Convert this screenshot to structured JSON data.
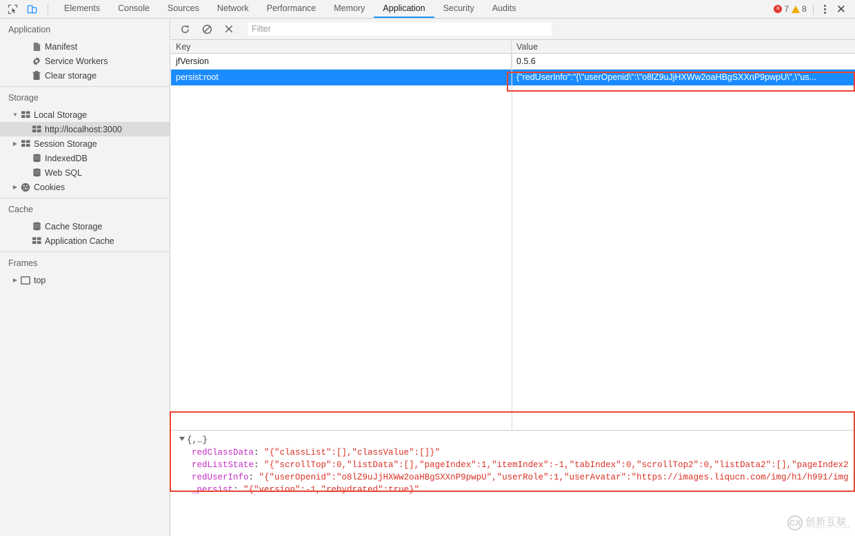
{
  "devtools": {
    "inspect_icon": "inspect-element-icon",
    "device_icon": "device-toolbar-icon",
    "tabs": [
      {
        "label": "Elements",
        "active": false
      },
      {
        "label": "Console",
        "active": false
      },
      {
        "label": "Sources",
        "active": false
      },
      {
        "label": "Network",
        "active": false
      },
      {
        "label": "Performance",
        "active": false
      },
      {
        "label": "Memory",
        "active": false
      },
      {
        "label": "Application",
        "active": true
      },
      {
        "label": "Security",
        "active": false
      },
      {
        "label": "Audits",
        "active": false
      }
    ],
    "error_count": "7",
    "warning_count": "8",
    "error_glyph": "×",
    "menu_icon": "kebab-menu-icon",
    "close_icon": "✕"
  },
  "sidebar": {
    "sections": [
      {
        "title": "Application",
        "items": [
          {
            "label": "Manifest",
            "icon": "manifest-icon",
            "arrow": false,
            "indent": 2,
            "selected": false
          },
          {
            "label": "Service Workers",
            "icon": "gear-icon",
            "arrow": false,
            "indent": 2,
            "selected": false
          },
          {
            "label": "Clear storage",
            "icon": "trash-icon",
            "arrow": false,
            "indent": 2,
            "selected": false
          }
        ]
      },
      {
        "title": "Storage",
        "items": [
          {
            "label": "Local Storage",
            "icon": "table-icon",
            "arrow": true,
            "expanded": true,
            "indent": 1,
            "selected": false
          },
          {
            "label": "http://localhost:3000",
            "icon": "table-icon",
            "arrow": false,
            "indent": 3,
            "selected": true
          },
          {
            "label": "Session Storage",
            "icon": "table-icon",
            "arrow": true,
            "expanded": false,
            "indent": 1,
            "selected": false
          },
          {
            "label": "IndexedDB",
            "icon": "database-icon",
            "arrow": false,
            "indent": 2,
            "selected": false
          },
          {
            "label": "Web SQL",
            "icon": "database-icon",
            "arrow": false,
            "indent": 2,
            "selected": false
          },
          {
            "label": "Cookies",
            "icon": "cookie-icon",
            "arrow": true,
            "expanded": false,
            "indent": 1,
            "selected": false
          }
        ]
      },
      {
        "title": "Cache",
        "items": [
          {
            "label": "Cache Storage",
            "icon": "database-icon",
            "arrow": false,
            "indent": 2,
            "selected": false
          },
          {
            "label": "Application Cache",
            "icon": "table-icon",
            "arrow": false,
            "indent": 2,
            "selected": false
          }
        ]
      },
      {
        "title": "Frames",
        "items": [
          {
            "label": "top",
            "icon": "frame-icon",
            "arrow": true,
            "expanded": false,
            "indent": 1,
            "selected": false
          }
        ]
      }
    ]
  },
  "toolbar": {
    "refresh_icon": "refresh-icon",
    "clear_icon": "clear-all-icon",
    "delete_icon": "delete-selected-icon",
    "filter_placeholder": "Filter",
    "filter_value": ""
  },
  "table": {
    "columns": [
      "Key",
      "Value"
    ],
    "rows": [
      {
        "key": "jfVersion",
        "value": "0.5.6",
        "selected": false
      },
      {
        "key": "persist:root",
        "value": "{\"redUserInfo\":\"{\\\"userOpenid\\\":\\\"o8lZ9uJjHXWw2oaHBgSXXnP9pwpU\\\",\\\"us...",
        "selected": true
      }
    ]
  },
  "detail": {
    "root": "{,…}",
    "properties": [
      {
        "name": "redClassData",
        "value": "\"{\"classList\":[],\"classValue\":[]}\""
      },
      {
        "name": "redListState",
        "value": "\"{\"scrollTop\":0,\"listData\":[],\"pageIndex\":1,\"itemIndex\":-1,\"tabIndex\":0,\"scrollTop2\":0,\"listData2\":[],\"pageIndex2"
      },
      {
        "name": "redUserInfo",
        "value": "\"{\"userOpenid\":\"o8lZ9uJjHXWw2oaHBgSXXnP9pwpU\",\"userRole\":1,\"userAvatar\":\"https://images.liqucn.com/img/h1/h991/img"
      },
      {
        "name": "_persist",
        "value": "\"{\"version\":-1,\"rehydrated\":true}\""
      }
    ]
  },
  "watermark": {
    "mark": "CX",
    "cn": "创新互联",
    "en": "CHUANGXIN HULIAN"
  },
  "colors": {
    "accent": "#2196f3",
    "selection": "#1a8cff",
    "annotation": "#e8442e",
    "error": "#e53935",
    "warning": "#f0ad00",
    "prop_name": "#c52ec5",
    "prop_value": "#d93025"
  }
}
